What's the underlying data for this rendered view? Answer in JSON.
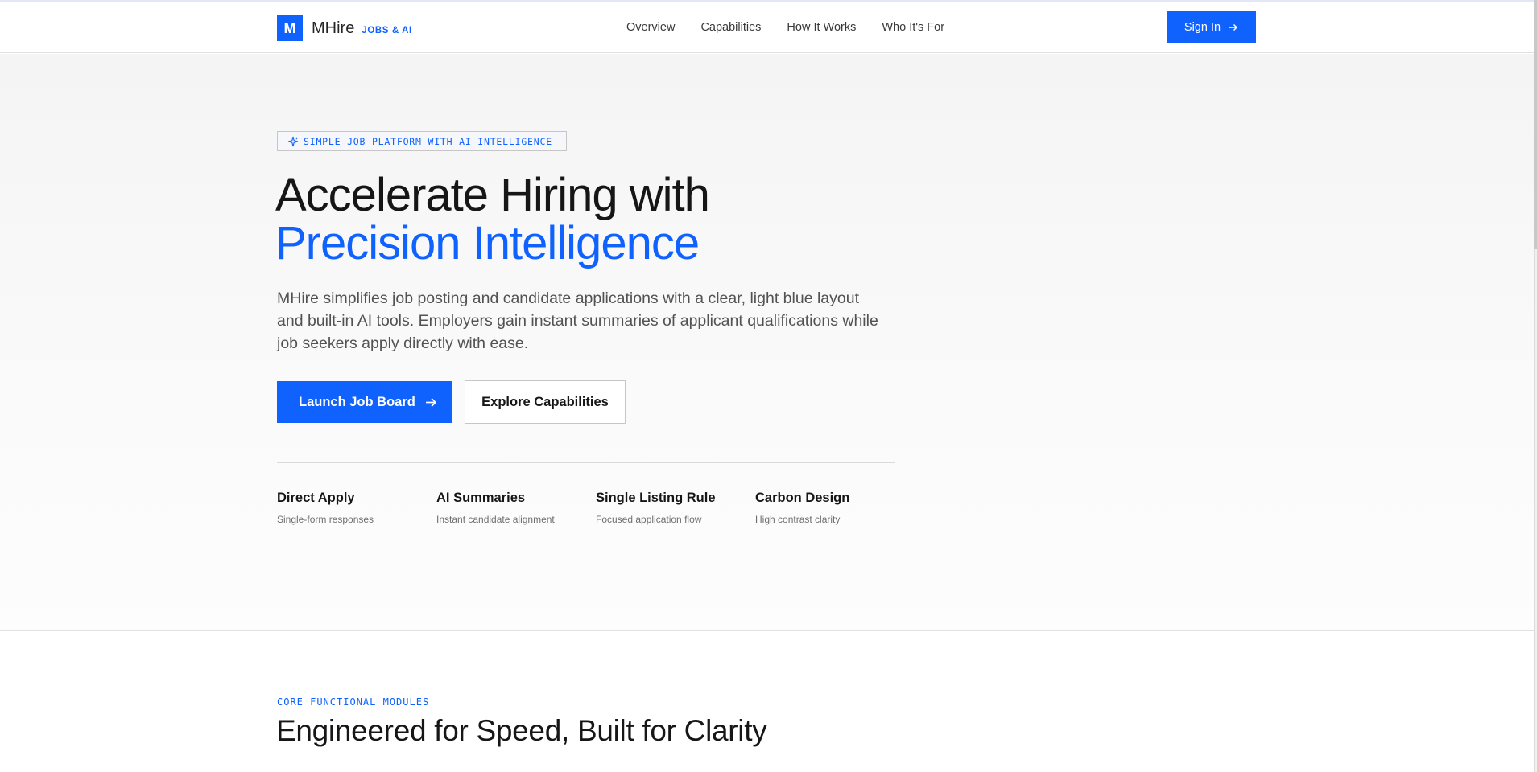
{
  "brand": {
    "mark": "M",
    "name": "MHire",
    "tag": "JOBS & AI",
    "accent": "#0f62fe"
  },
  "nav": {
    "items": [
      "Overview",
      "Capabilities",
      "How It Works",
      "Who It's For"
    ],
    "signin_label": "Sign In",
    "signin_icon": "arrow-right-icon"
  },
  "hero": {
    "badge_icon": "sparkle-icon",
    "badge_text": "SIMPLE JOB PLATFORM WITH AI INTELLIGENCE",
    "headline_line1": "Accelerate Hiring with",
    "headline_line2": "Precision Intelligence",
    "lead": "MHire simplifies job posting and candidate applications with a clear, light blue layout and built-in AI tools. Employers gain instant summaries of applicant qualifications while job seekers apply directly with ease.",
    "primary_cta": "Launch Job Board",
    "secondary_cta": "Explore Capabilities",
    "features": [
      {
        "title": "Direct Apply",
        "subtitle": "Single-form responses"
      },
      {
        "title": "AI Summaries",
        "subtitle": "Instant candidate alignment"
      },
      {
        "title": "Single Listing Rule",
        "subtitle": "Focused application flow"
      },
      {
        "title": "Carbon Design",
        "subtitle": "High contrast clarity"
      }
    ]
  },
  "modules": {
    "eyebrow": "CORE FUNCTIONAL MODULES",
    "title": "Engineered for Speed, Built for Clarity"
  }
}
